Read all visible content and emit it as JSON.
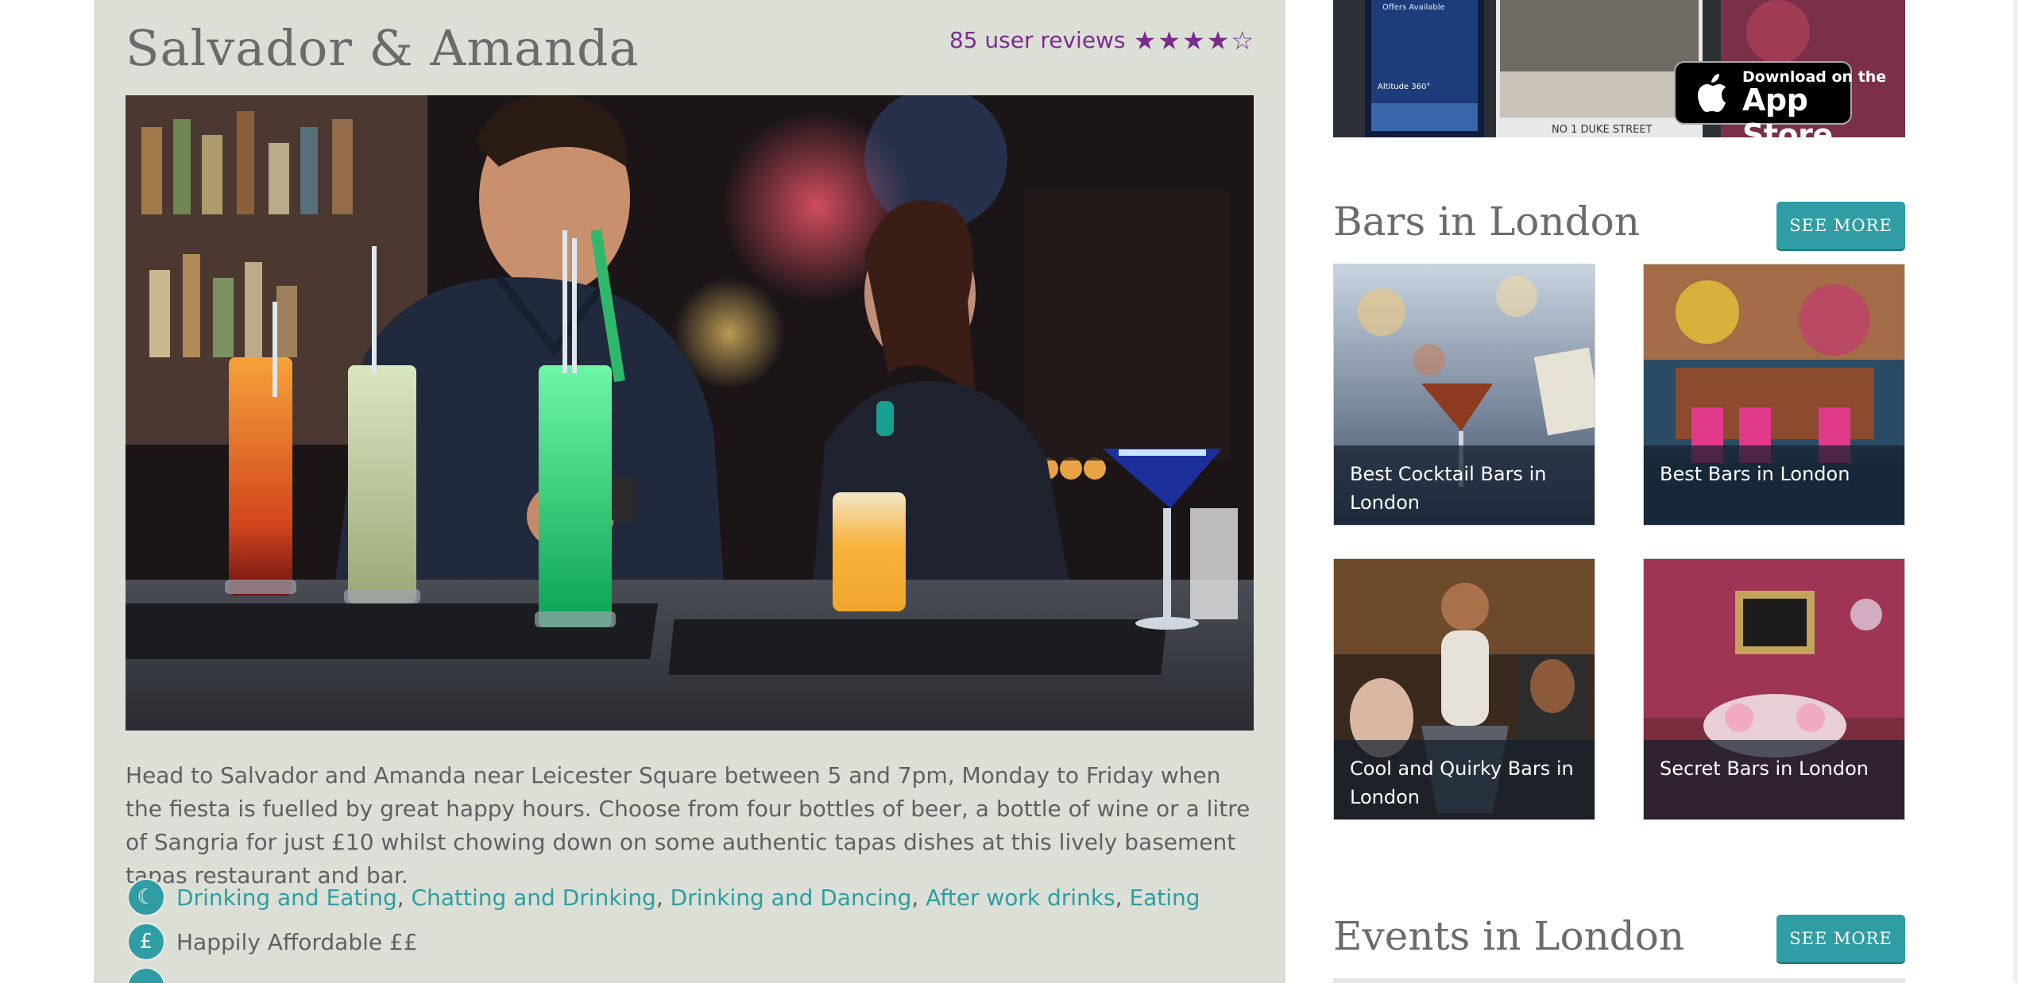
{
  "venue": {
    "title": "Salvador & Amanda",
    "reviews_text": "85 user reviews",
    "rating": 4,
    "rating_max": 5,
    "description": "Head to Salvador and Amanda near Leicester Square between 5 and 7pm, Monday to Friday when the fiesta is fuelled by great happy hours. Choose from four bottles of beer, a bottle of wine or a litre of Sangria for just £10 whilst chowing down on some authentic tapas dishes at this lively basement tapas restaurant and bar.",
    "tags": [
      "Drinking and Eating",
      "Chatting and Drinking",
      "Drinking and Dancing",
      "After work drinks",
      "Eating"
    ],
    "tag_separator": ",",
    "price_icon": "£",
    "price_text": "Happily Affordable ££"
  },
  "app_banner": {
    "download_small": "Download on the",
    "download_large": "App Store",
    "caption": "NO 1 DUKE STREET",
    "phone_header": "Offers Available",
    "phone_label": "Altitude 360°"
  },
  "bars": {
    "title": "Bars in London",
    "see_more": "SEE MORE",
    "tiles": [
      {
        "label": "Best Cocktail Bars in London"
      },
      {
        "label": "Best Bars in London"
      },
      {
        "label": "Cool and Quirky Bars in London"
      },
      {
        "label": "Secret Bars in London"
      }
    ]
  },
  "events": {
    "title": "Events in London",
    "see_more": "SEE MORE"
  },
  "colors": {
    "accent": "#2f9da3",
    "rating": "#7b2d8e",
    "card_bg": "#dcdfd5",
    "text": "#606060"
  },
  "icons": [
    "star-icon",
    "moon-icon",
    "pound-icon",
    "apple-icon"
  ]
}
